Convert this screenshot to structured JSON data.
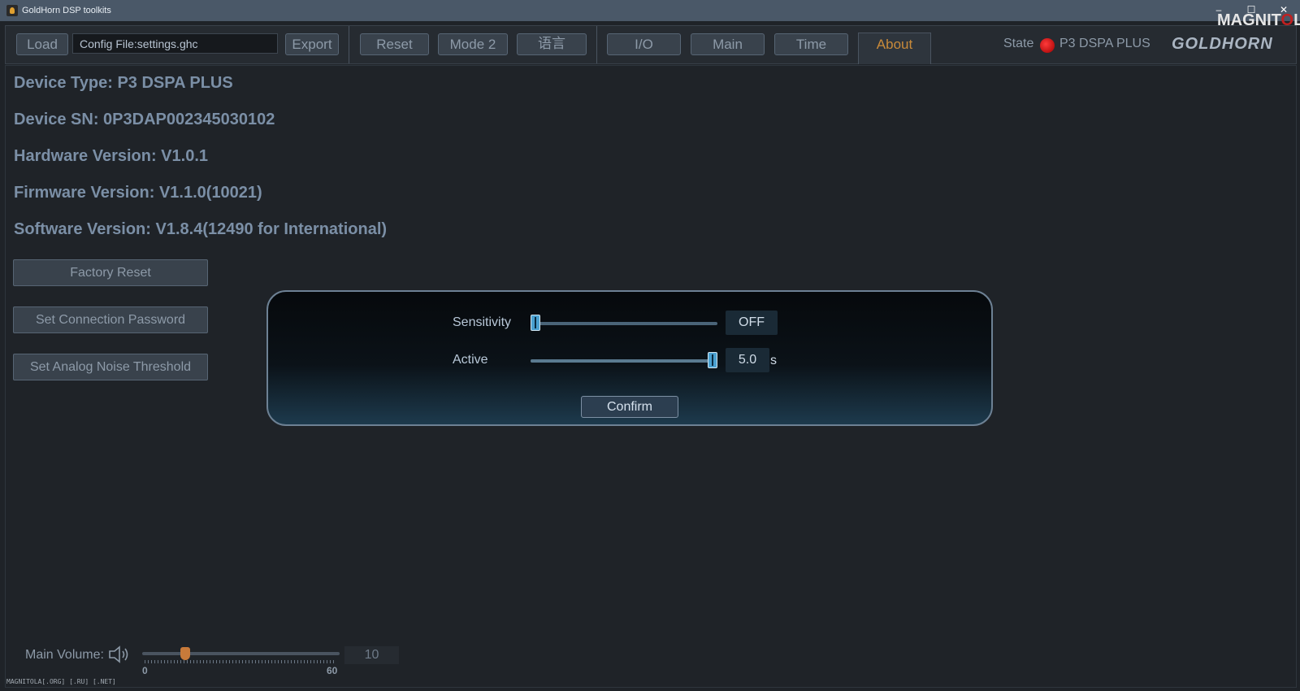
{
  "window": {
    "title": "GoldHorn DSP toolkits",
    "minimize": "–",
    "maximize": "☐",
    "close": "✕",
    "watermark_logo_a": "MAGNIT",
    "watermark_logo_o": "O",
    "watermark_logo_b": "LA"
  },
  "toolbar": {
    "load_label": "Load",
    "config_file": "Config File:settings.ghc",
    "export_label": "Export",
    "reset_label": "Reset",
    "mode_label": "Mode 2",
    "language_label": "语言",
    "tabs": [
      {
        "label": "I/O"
      },
      {
        "label": "Main"
      },
      {
        "label": "Time"
      },
      {
        "label": "About",
        "active": true
      }
    ],
    "state_label": "State",
    "state_color": "#e02020",
    "device_name": "P3 DSPA PLUS",
    "brand": "GOLDHORN"
  },
  "about": {
    "device_type": "Device Type: P3 DSPA PLUS",
    "device_sn": "Device SN: 0P3DAP002345030102",
    "hardware_version": "Hardware Version: V1.0.1",
    "firmware_version": "Firmware Version: V1.1.0(10021)",
    "software_version": "Software Version: V1.8.4(12490 for International)",
    "factory_reset_label": "Factory Reset",
    "set_password_label": "Set Connection Password",
    "set_noise_label": "Set Analog Noise Threshold"
  },
  "dialog": {
    "sensitivity_label": "Sensitivity",
    "sensitivity_value": "OFF",
    "sensitivity_level": 0.0,
    "active_label": "Active",
    "active_value": "5.0",
    "active_unit": "s",
    "active_level": 1.0,
    "confirm_label": "Confirm"
  },
  "volume": {
    "label": "Main Volume:",
    "min": "0",
    "max": "60",
    "value": "10",
    "level": 0.1667
  },
  "footer": {
    "watermark": "MAGNITOLA[.ORG] [.RU] [.NET]"
  },
  "colors": {
    "accent_active_tab": "#c88a3a",
    "volume_handle": "#c87a3a",
    "slider_handle": "#4aa0d0"
  }
}
